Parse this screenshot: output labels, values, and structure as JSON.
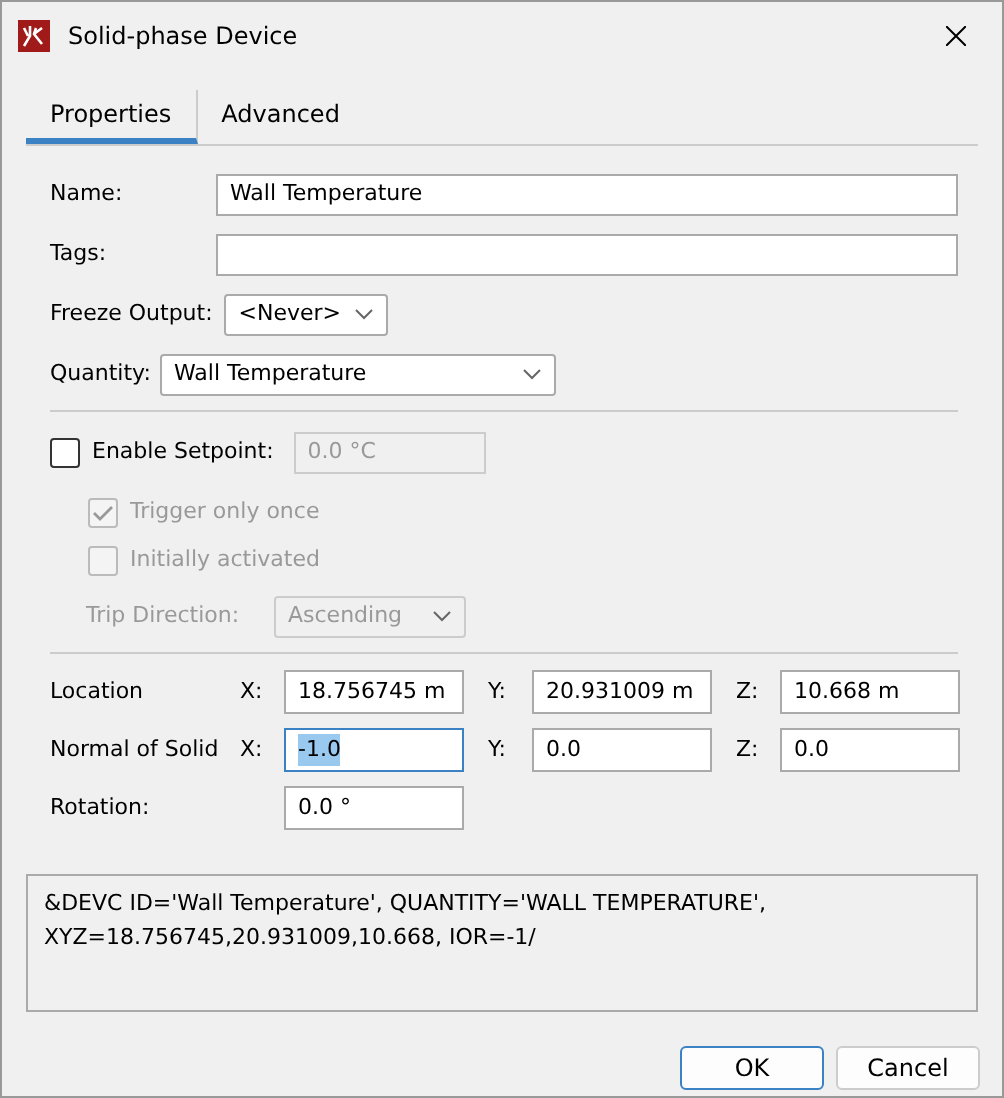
{
  "window": {
    "title": "Solid-phase Device"
  },
  "tabs": [
    {
      "label": "Properties",
      "selected": true
    },
    {
      "label": "Advanced",
      "selected": false
    }
  ],
  "name": {
    "label": "Name:",
    "value": "Wall Temperature"
  },
  "tags": {
    "label": "Tags:"
  },
  "freeze_output": {
    "label": "Freeze Output:",
    "value": "<Never>"
  },
  "quantity": {
    "label": "Quantity:",
    "value": "Wall Temperature"
  },
  "setpoint": {
    "label": "Enable Setpoint:",
    "checked": false,
    "value": "0.0 °C",
    "disabled": true
  },
  "options": [
    {
      "label": "Trigger only once",
      "checked": true,
      "disabled": true
    },
    {
      "label": "Initially activated",
      "checked": false,
      "disabled": true
    }
  ],
  "trip_direction": {
    "label": "Trip Direction:",
    "value": "Ascending",
    "disabled": true
  },
  "vectors": [
    {
      "label": "Location",
      "fields": [
        {
          "axis": "X:",
          "value": "18.756745 m",
          "focused": false
        },
        {
          "axis": "Y:",
          "value": "20.931009 m",
          "focused": false
        },
        {
          "axis": "Z:",
          "value": "10.668 m",
          "focused": false
        }
      ]
    },
    {
      "label": "Normal of Solid",
      "fields": [
        {
          "axis": "X:",
          "value": "-1.0",
          "focused": true
        },
        {
          "axis": "Y:",
          "value": "0.0",
          "focused": false
        },
        {
          "axis": "Z:",
          "value": "0.0",
          "focused": false
        }
      ]
    }
  ],
  "rotation": {
    "label": "Rotation:",
    "value": "0.0 °"
  },
  "preview": [
    "&DEVC ID='Wall Temperature', QUANTITY='WALL TEMPERATURE',",
    "XYZ=18.756745,20.931009,10.668, IOR=-1/"
  ],
  "buttons": [
    {
      "label": "OK",
      "default": true
    },
    {
      "label": "Cancel",
      "default": false
    }
  ]
}
